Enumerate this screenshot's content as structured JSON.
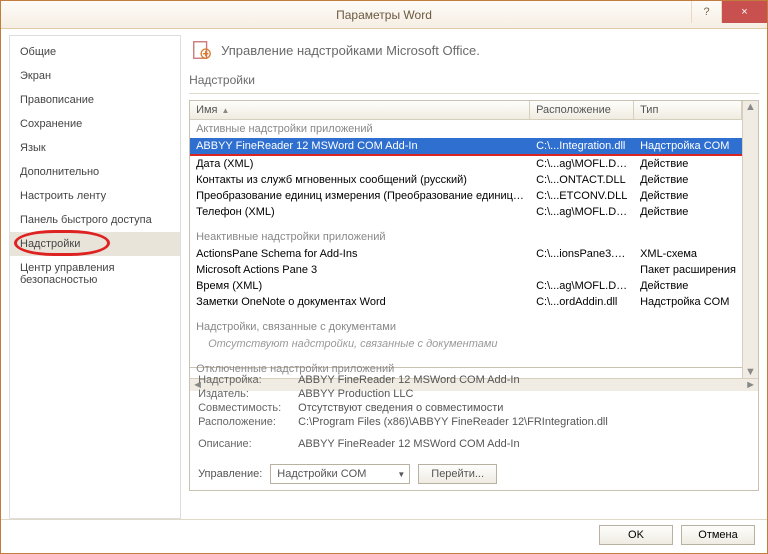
{
  "title": "Параметры Word",
  "titlebar": {
    "help": "?",
    "close": "×"
  },
  "sidebar": {
    "items": [
      "Общие",
      "Экран",
      "Правописание",
      "Сохранение",
      "Язык",
      "Дополнительно",
      "Настроить ленту",
      "Панель быстрого доступа",
      "Надстройки",
      "Центр управления безопасностью"
    ],
    "active_index": 8
  },
  "header": {
    "title": "Управление надстройками Microsoft Office."
  },
  "section": "Надстройки",
  "columns": {
    "name": "Имя",
    "location": "Расположение",
    "type": "Тип"
  },
  "groups": [
    {
      "label": "Активные надстройки приложений",
      "rows": [
        {
          "name": "ABBYY FineReader 12 MSWord COM Add-In",
          "loc": "C:\\...Integration.dll",
          "type": "Надстройка COM",
          "selected": true
        },
        {
          "name": "Дата (XML)",
          "loc": "C:\\...ag\\MOFL.DLL",
          "type": "Действие"
        },
        {
          "name": "Контакты из служб мгновенных сообщений (русский)",
          "loc": "C:\\...ONTACT.DLL",
          "type": "Действие"
        },
        {
          "name": "Преобразование единиц измерения (Преобразование единиц измерения)",
          "loc": "C:\\...ETCONV.DLL",
          "type": "Действие"
        },
        {
          "name": "Телефон (XML)",
          "loc": "C:\\...ag\\MOFL.DLL",
          "type": "Действие"
        }
      ]
    },
    {
      "label": "Неактивные надстройки приложений",
      "rows": [
        {
          "name": "ActionsPane Schema for Add-Ins",
          "loc": "C:\\...ionsPane3.xsd",
          "type": "XML-схема"
        },
        {
          "name": "Microsoft Actions Pane 3",
          "loc": "",
          "type": "Пакет расширения"
        },
        {
          "name": "Время (XML)",
          "loc": "C:\\...ag\\MOFL.DLL",
          "type": "Действие"
        },
        {
          "name": "Заметки OneNote о документах Word",
          "loc": "C:\\...ordAddin.dll",
          "type": "Надстройка COM"
        }
      ]
    },
    {
      "label": "Надстройки, связанные с документами",
      "empty_note": "Отсутствуют надстройки, связанные с документами"
    },
    {
      "label": "Отключенные надстройки приложений"
    }
  ],
  "details": {
    "labels": {
      "addon": "Надстройка:",
      "publisher": "Издатель:",
      "compat": "Совместимость:",
      "location": "Расположение:",
      "description": "Описание:"
    },
    "addon": "ABBYY FineReader 12 MSWord COM Add-In",
    "publisher": "ABBYY Production LLC",
    "compat": "Отсутствуют сведения о совместимости",
    "location": "C:\\Program Files (x86)\\ABBYY FineReader 12\\FRIntegration.dll",
    "description": "ABBYY FineReader 12 MSWord COM Add-In"
  },
  "manage": {
    "label": "Управление:",
    "combo": "Надстройки COM",
    "go": "Перейти..."
  },
  "footer": {
    "ok": "OK",
    "cancel": "Отмена"
  }
}
